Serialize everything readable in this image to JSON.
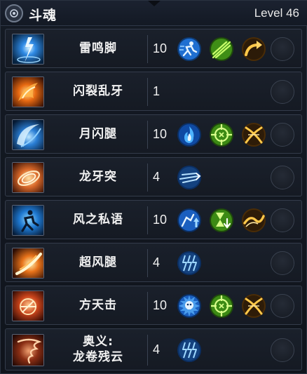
{
  "header": {
    "title": "斗魂",
    "level": "Level 46"
  },
  "skills": [
    {
      "name": "雷鸣脚",
      "rank": "10",
      "icon": "lightning-kick-icon",
      "runes": [
        "run-dash-icon",
        "green-slash-icon",
        "gold-arrow-icon"
      ]
    },
    {
      "name": "闪裂乱牙",
      "rank": "1",
      "icon": "fire-fang-icon",
      "runes": []
    },
    {
      "name": "月闪腿",
      "rank": "10",
      "icon": "moon-kick-icon",
      "runes": [
        "blue-flame-icon",
        "green-target-icon",
        "gold-cross-slash-icon"
      ]
    },
    {
      "name": "龙牙突",
      "rank": "4",
      "icon": "dragon-fang-icon",
      "runes": [
        "blue-streak-icon"
      ]
    },
    {
      "name": "风之私语",
      "rank": "10",
      "icon": "wind-whisper-icon",
      "runes": [
        "stat-up-icon",
        "hourglass-down-icon",
        "gold-wave-icon"
      ]
    },
    {
      "name": "超风腿",
      "rank": "4",
      "icon": "super-wind-kick-icon",
      "runes": [
        "blue-claw-icon"
      ]
    },
    {
      "name": "方天击",
      "rank": "10",
      "icon": "heaven-strike-icon",
      "runes": [
        "skull-burst-icon",
        "green-target-icon",
        "gold-cross-slash-icon"
      ]
    },
    {
      "name": "奥义:\n龙卷残云",
      "rank": "4",
      "icon": "tornado-icon",
      "runes": [
        "blue-claw-icon"
      ]
    }
  ],
  "colors": {
    "blue_rune": "#2f7fe0",
    "green_rune": "#5fcf2a",
    "gold_rune": "#e0a62a"
  }
}
